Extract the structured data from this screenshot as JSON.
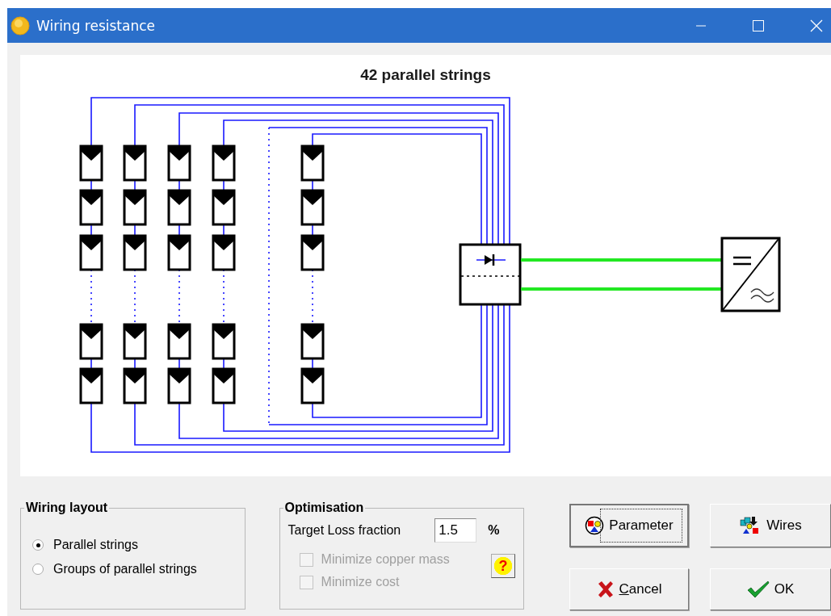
{
  "window": {
    "title": "Wiring resistance"
  },
  "diagram": {
    "title": "42 parallel strings"
  },
  "wiring_layout": {
    "title": "Wiring layout",
    "options": [
      {
        "label": "Parallel strings",
        "selected": true
      },
      {
        "label": "Groups of parallel strings",
        "selected": false
      }
    ]
  },
  "optimisation": {
    "title": "Optimisation",
    "target_loss": {
      "label": "Target Loss fraction",
      "value": "1.5",
      "unit": "%"
    },
    "options": [
      {
        "label": "Minimize copper mass",
        "checked": false,
        "disabled": true
      },
      {
        "label": "Minimize cost",
        "checked": false,
        "disabled": true
      }
    ],
    "help_button": "?"
  },
  "buttons": [
    {
      "label": "Parameter",
      "kind": "parameter",
      "focused": true,
      "accel": false
    },
    {
      "label": "Wires",
      "kind": "wires",
      "focused": false,
      "accel": false
    },
    {
      "label": "Cancel",
      "kind": "cancel",
      "focused": false,
      "accel": true
    },
    {
      "label": "OK",
      "kind": "ok",
      "focused": false,
      "accel": false
    }
  ]
}
